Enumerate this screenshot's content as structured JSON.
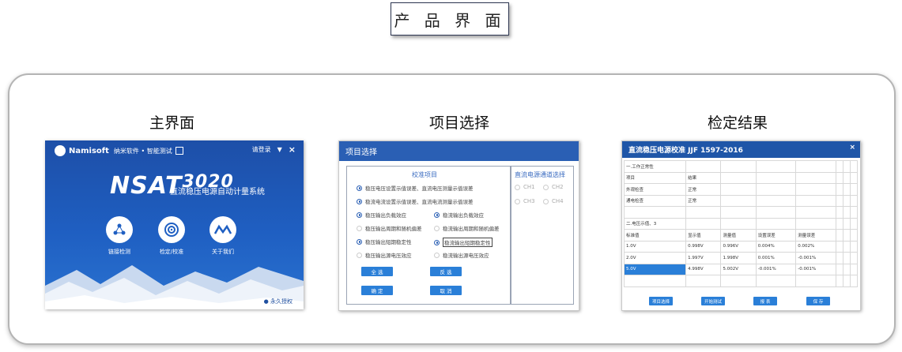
{
  "header": {
    "title": "产 品 界 面"
  },
  "sections": {
    "main": "主界面",
    "project": "项目选择",
    "result": "检定结果"
  },
  "main_screen": {
    "brand": "Namisoft",
    "subtitle_company": "纳米软件 • 智能测试",
    "top_right": {
      "login": "请登录",
      "menu_icon": "menu-icon",
      "close": "×"
    },
    "product_name": "NSAT",
    "product_number": "3020",
    "product_subtitle": "直流稳压电源自动计量系统",
    "buttons": [
      {
        "label": "链接检测",
        "icon": "network-icon"
      },
      {
        "label": "检定/校准",
        "icon": "target-icon"
      },
      {
        "label": "关于我们",
        "icon": "logo-icon"
      }
    ],
    "footer": "永久授权"
  },
  "project_screen": {
    "title": "项目选择",
    "left_panel_title": "校准项目",
    "right_panel_title": "直流电源通道选择",
    "options": [
      {
        "label": "稳压电压设置示值误差、直流电压测量示值误差",
        "checked": true
      },
      {
        "label": "稳流电流设置示值误差、直流电流测量示值误差",
        "checked": true
      },
      {
        "label": "稳压输出负载效应",
        "checked": true
      },
      {
        "label": "稳流输出负载效应",
        "checked": true
      },
      {
        "label": "稳压输出周期和随机偏差",
        "checked": false
      },
      {
        "label": "稳流输出周期和随机偏差",
        "checked": false
      },
      {
        "label": "稳压输出短期稳定性",
        "checked": true
      },
      {
        "label": "稳流输出短期稳定性",
        "checked": true
      },
      {
        "label": "稳压输出源电压效应",
        "checked": false
      },
      {
        "label": "稳流输出源电压效应",
        "checked": false
      }
    ],
    "channels": [
      "CH1",
      "CH2",
      "CH3",
      "CH4"
    ],
    "buttons": {
      "select_all": "全 选",
      "invert": "反 选",
      "confirm": "确 定",
      "cancel": "取 消"
    }
  },
  "result_screen": {
    "title": "直流稳压电源校准   JJF 1597-2016",
    "close": "×",
    "rows": [
      [
        "一.工作正常性",
        "",
        "",
        "",
        "",
        "",
        "",
        ""
      ],
      [
        "项目",
        "结果",
        "",
        "",
        "",
        "",
        "",
        ""
      ],
      [
        "外观检查",
        "正常",
        "",
        "",
        "",
        "",
        "",
        ""
      ],
      [
        "通电检查",
        "正常",
        "",
        "",
        "",
        "",
        "",
        ""
      ],
      [
        "",
        "",
        "",
        "",
        "",
        "",
        "",
        ""
      ],
      [
        "二.电压示值、3",
        "",
        "",
        "",
        "",
        "",
        "",
        ""
      ],
      [
        "标准值",
        "显示值",
        "测量值",
        "设置误差",
        "测量误差",
        "",
        "",
        ""
      ],
      [
        "1.0V",
        "0.998V",
        "0.996V",
        "0.004%",
        "0.002%",
        "",
        "",
        ""
      ],
      [
        "2.0V",
        "1.997V",
        "1.998V",
        "0.001%",
        "-0.001%",
        "",
        "",
        ""
      ],
      [
        "5.0V",
        "4.998V",
        "5.002V",
        "-0.001%",
        "-0.001%",
        "",
        "",
        ""
      ],
      [
        "",
        "",
        "",
        "",
        "",
        "",
        "",
        ""
      ]
    ],
    "buttons": [
      "项目选择",
      "开始测试",
      "报 表",
      "保 存"
    ]
  }
}
